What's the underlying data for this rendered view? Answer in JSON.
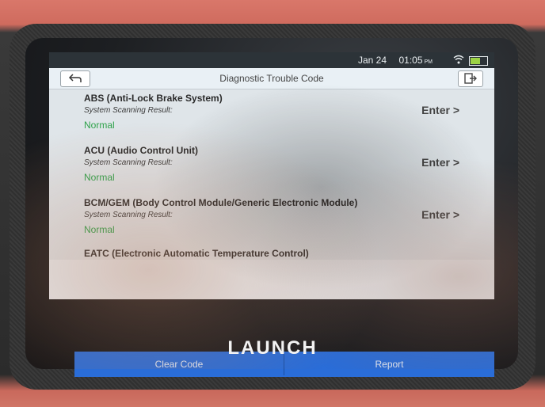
{
  "statusbar": {
    "date": "Jan 24",
    "time": "01:05",
    "ampm": "PM"
  },
  "header": {
    "title": "Diagnostic Trouble Code",
    "back_icon": "back-arrow-icon",
    "exit_icon": "exit-icon"
  },
  "systems": [
    {
      "name": "ABS (Anti-Lock Brake System)",
      "result_label": "System Scanning Result:",
      "status": "Normal",
      "action": "Enter >"
    },
    {
      "name": "ACU (Audio Control Unit)",
      "result_label": "System Scanning Result:",
      "status": "Normal",
      "action": "Enter >"
    },
    {
      "name": "BCM/GEM (Body Control Module/Generic Electronic Module)",
      "result_label": "System Scanning Result:",
      "status": "Normal",
      "action": "Enter >"
    },
    {
      "name": "EATC (Electronic Automatic Temperature Control)",
      "result_label": "",
      "status": "",
      "action": ""
    }
  ],
  "footer": {
    "clear_label": "Clear Code",
    "report_label": "Report"
  },
  "brand": "LAUNCH",
  "colors": {
    "accent": "#2a6dd8",
    "normal_status": "#2ea24a"
  }
}
